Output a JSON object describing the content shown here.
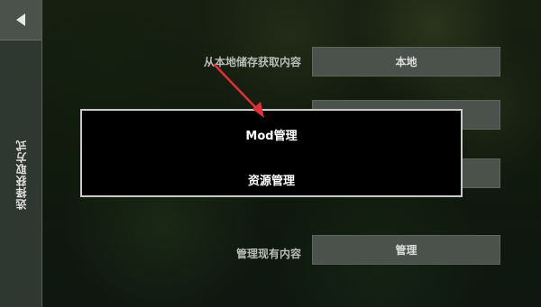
{
  "sidebar": {
    "back_icon": "back-arrow-icon",
    "tab_label": "选择获取方式"
  },
  "rows": [
    {
      "label": "从本地储存获取内容",
      "button": "本地"
    },
    {
      "label": "",
      "button": ""
    },
    {
      "label": "",
      "button": ""
    },
    {
      "label": "管理现有内容",
      "button": "管理"
    }
  ],
  "modal": {
    "items": [
      "Mod管理",
      "资源管理"
    ]
  },
  "colors": {
    "annotation_arrow": "#e0303a",
    "modal_border": "#c9c9c9",
    "button_bg": "#4b524c"
  }
}
